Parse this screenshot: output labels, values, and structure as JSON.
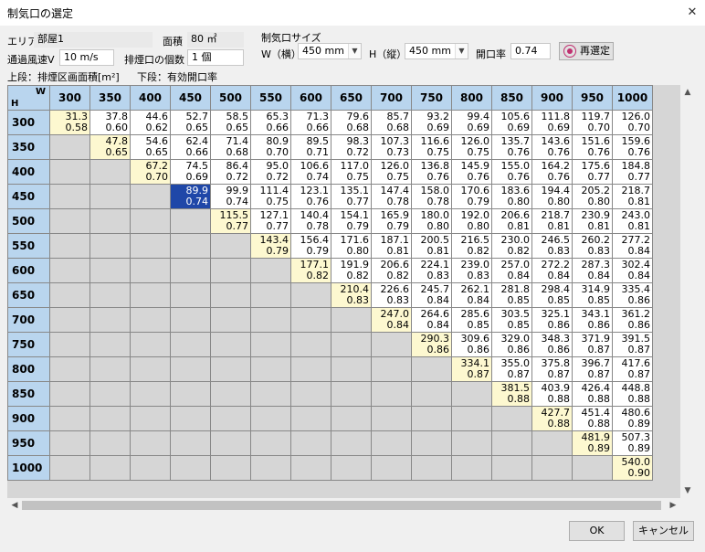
{
  "window": {
    "title": "制気口の選定"
  },
  "form": {
    "area_label": "エリア",
    "area_value": "部屋1",
    "floor_area_label": "面積",
    "floor_area_value": "80 ㎡",
    "velocity_label": "通過風速V",
    "velocity_value": "10 m/s",
    "outlet_count_label": "排煙口の個数",
    "outlet_count_value": "1 個",
    "size_group_label": "制気口サイズ",
    "w_label": "W（横）",
    "w_value": "450 mm",
    "h_label": "H（縦）",
    "h_value": "450 mm",
    "opening_ratio_label": "開口率",
    "opening_ratio_value": "0.74",
    "reselect_label": "再選定",
    "legend_upper": "上段：排煙区画面積[m²]",
    "legend_lower": "下段：有効開口率"
  },
  "grid": {
    "corner_w": "W",
    "corner_h": "H",
    "columns": [
      "300",
      "350",
      "400",
      "450",
      "500",
      "550",
      "600",
      "650",
      "700",
      "750",
      "800",
      "850",
      "900",
      "950",
      "1000"
    ],
    "rows": [
      "300",
      "350",
      "400",
      "450",
      "500",
      "550",
      "600",
      "650",
      "700",
      "750",
      "800",
      "850",
      "900",
      "950",
      "1000"
    ],
    "selected": {
      "row": 3,
      "col": 3
    },
    "cells": [
      [
        [
          "31.3",
          "0.58"
        ],
        [
          "37.8",
          "0.60"
        ],
        [
          "44.6",
          "0.62"
        ],
        [
          "52.7",
          "0.65"
        ],
        [
          "58.5",
          "0.65"
        ],
        [
          "65.3",
          "0.66"
        ],
        [
          "71.3",
          "0.66"
        ],
        [
          "79.6",
          "0.68"
        ],
        [
          "85.7",
          "0.68"
        ],
        [
          "93.2",
          "0.69"
        ],
        [
          "99.4",
          "0.69"
        ],
        [
          "105.6",
          "0.69"
        ],
        [
          "111.8",
          "0.69"
        ],
        [
          "119.7",
          "0.70"
        ],
        [
          "126.0",
          "0.70"
        ]
      ],
      [
        [
          "47.8",
          "0.65"
        ],
        [
          "54.6",
          "0.65"
        ],
        [
          "62.4",
          "0.66"
        ],
        [
          "71.4",
          "0.68"
        ],
        [
          "80.9",
          "0.70"
        ],
        [
          "89.5",
          "0.71"
        ],
        [
          "98.3",
          "0.72"
        ],
        [
          "107.3",
          "0.73"
        ],
        [
          "116.6",
          "0.75"
        ],
        [
          "126.0",
          "0.75"
        ],
        [
          "135.7",
          "0.76"
        ],
        [
          "143.6",
          "0.76"
        ],
        [
          "151.6",
          "0.76"
        ],
        [
          "159.6",
          "0.76"
        ]
      ],
      [
        [
          "67.2",
          "0.70"
        ],
        [
          "74.5",
          "0.69"
        ],
        [
          "86.4",
          "0.72"
        ],
        [
          "95.0",
          "0.72"
        ],
        [
          "106.6",
          "0.74"
        ],
        [
          "117.0",
          "0.75"
        ],
        [
          "126.0",
          "0.75"
        ],
        [
          "136.8",
          "0.76"
        ],
        [
          "145.9",
          "0.76"
        ],
        [
          "155.0",
          "0.76"
        ],
        [
          "164.2",
          "0.76"
        ],
        [
          "175.6",
          "0.77"
        ],
        [
          "184.8",
          "0.77"
        ]
      ],
      [
        [
          "89.9",
          "0.74"
        ],
        [
          "99.9",
          "0.74"
        ],
        [
          "111.4",
          "0.75"
        ],
        [
          "123.1",
          "0.76"
        ],
        [
          "135.1",
          "0.77"
        ],
        [
          "147.4",
          "0.78"
        ],
        [
          "158.0",
          "0.78"
        ],
        [
          "170.6",
          "0.79"
        ],
        [
          "183.6",
          "0.80"
        ],
        [
          "194.4",
          "0.80"
        ],
        [
          "205.2",
          "0.80"
        ],
        [
          "218.7",
          "0.81"
        ]
      ],
      [
        [
          "115.5",
          "0.77"
        ],
        [
          "127.1",
          "0.77"
        ],
        [
          "140.4",
          "0.78"
        ],
        [
          "154.1",
          "0.79"
        ],
        [
          "165.9",
          "0.79"
        ],
        [
          "180.0",
          "0.80"
        ],
        [
          "192.0",
          "0.80"
        ],
        [
          "206.6",
          "0.81"
        ],
        [
          "218.7",
          "0.81"
        ],
        [
          "230.9",
          "0.81"
        ],
        [
          "243.0",
          "0.81"
        ]
      ],
      [
        [
          "143.4",
          "0.79"
        ],
        [
          "156.4",
          "0.79"
        ],
        [
          "171.6",
          "0.80"
        ],
        [
          "187.1",
          "0.81"
        ],
        [
          "200.5",
          "0.81"
        ],
        [
          "216.5",
          "0.82"
        ],
        [
          "230.0",
          "0.82"
        ],
        [
          "246.5",
          "0.83"
        ],
        [
          "260.2",
          "0.83"
        ],
        [
          "277.2",
          "0.84"
        ]
      ],
      [
        [
          "177.1",
          "0.82"
        ],
        [
          "191.9",
          "0.82"
        ],
        [
          "206.6",
          "0.82"
        ],
        [
          "224.1",
          "0.83"
        ],
        [
          "239.0",
          "0.83"
        ],
        [
          "257.0",
          "0.84"
        ],
        [
          "272.2",
          "0.84"
        ],
        [
          "287.3",
          "0.84"
        ],
        [
          "302.4",
          "0.84"
        ]
      ],
      [
        [
          "210.4",
          "0.83"
        ],
        [
          "226.6",
          "0.83"
        ],
        [
          "245.7",
          "0.84"
        ],
        [
          "262.1",
          "0.84"
        ],
        [
          "281.8",
          "0.85"
        ],
        [
          "298.4",
          "0.85"
        ],
        [
          "314.9",
          "0.85"
        ],
        [
          "335.4",
          "0.86"
        ]
      ],
      [
        [
          "247.0",
          "0.84"
        ],
        [
          "264.6",
          "0.84"
        ],
        [
          "285.6",
          "0.85"
        ],
        [
          "303.5",
          "0.85"
        ],
        [
          "325.1",
          "0.86"
        ],
        [
          "343.1",
          "0.86"
        ],
        [
          "361.2",
          "0.86"
        ]
      ],
      [
        [
          "290.3",
          "0.86"
        ],
        [
          "309.6",
          "0.86"
        ],
        [
          "329.0",
          "0.86"
        ],
        [
          "348.3",
          "0.86"
        ],
        [
          "371.9",
          "0.87"
        ],
        [
          "391.5",
          "0.87"
        ]
      ],
      [
        [
          "334.1",
          "0.87"
        ],
        [
          "355.0",
          "0.87"
        ],
        [
          "375.8",
          "0.87"
        ],
        [
          "396.7",
          "0.87"
        ],
        [
          "417.6",
          "0.87"
        ]
      ],
      [
        [
          "381.5",
          "0.88"
        ],
        [
          "403.9",
          "0.88"
        ],
        [
          "426.4",
          "0.88"
        ],
        [
          "448.8",
          "0.88"
        ]
      ],
      [
        [
          "427.7",
          "0.88"
        ],
        [
          "451.4",
          "0.88"
        ],
        [
          "480.6",
          "0.89"
        ]
      ],
      [
        [
          "481.9",
          "0.89"
        ],
        [
          "507.3",
          "0.89"
        ]
      ],
      [
        [
          "540.0",
          "0.90"
        ]
      ]
    ]
  },
  "footer": {
    "ok_label": "OK",
    "cancel_label": "キャンセル"
  }
}
